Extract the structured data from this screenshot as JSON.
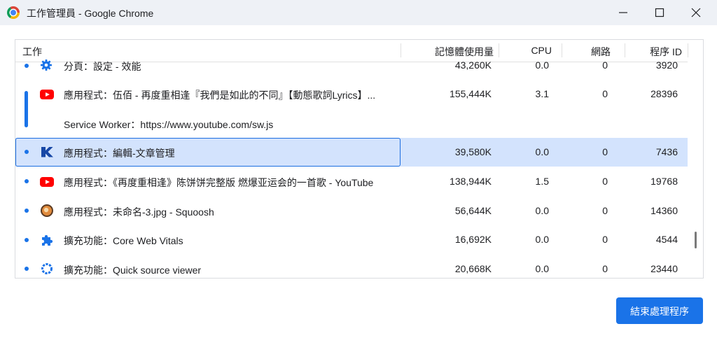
{
  "window": {
    "title": "工作管理員 - Google Chrome"
  },
  "table": {
    "headers": {
      "task": "工作",
      "memory": "記憶體使用量",
      "cpu": "CPU",
      "network": "網路",
      "pid": "程序 ID"
    },
    "rows": [
      {
        "icon": "gear-icon",
        "name": "分頁：設定 - 效能",
        "memory": "43,260K",
        "cpu": "0.0",
        "network": "0",
        "pid": "3920"
      },
      {
        "icon": "youtube-icon",
        "name": "應用程式：伍佰 - 再度重相逢『我們是如此的不同』【動態歌詞Lyrics】...",
        "memory": "155,444K",
        "cpu": "3.1",
        "network": "0",
        "pid": "28396"
      },
      {
        "icon": "",
        "name": "Service Worker：https://www.youtube.com/sw.js",
        "memory": "",
        "cpu": "",
        "network": "",
        "pid": ""
      },
      {
        "icon": "k-logo-icon",
        "name": "應用程式：編輯-文章管理",
        "memory": "39,580K",
        "cpu": "0.0",
        "network": "0",
        "pid": "7436"
      },
      {
        "icon": "youtube-icon",
        "name": "應用程式：《再度重相逢》陈饼饼完整版 燃爆亚运会的一首歌 - YouTube",
        "memory": "138,944K",
        "cpu": "1.5",
        "network": "0",
        "pid": "19768"
      },
      {
        "icon": "squoosh-icon",
        "name": "應用程式：未命名-3.jpg - Squoosh",
        "memory": "56,644K",
        "cpu": "0.0",
        "network": "0",
        "pid": "14360"
      },
      {
        "icon": "puzzle-icon",
        "name": "擴充功能：Core Web Vitals",
        "memory": "16,692K",
        "cpu": "0.0",
        "network": "0",
        "pid": "4544"
      },
      {
        "icon": "ring-icon",
        "name": "擴充功能：Quick source viewer",
        "memory": "20,668K",
        "cpu": "0.0",
        "network": "0",
        "pid": "23440"
      }
    ]
  },
  "actions": {
    "end_process": "結束處理程序"
  },
  "colors": {
    "accent": "#1a73e8",
    "selected_row": "#d3e3fd",
    "youtube": "#ff0000"
  }
}
